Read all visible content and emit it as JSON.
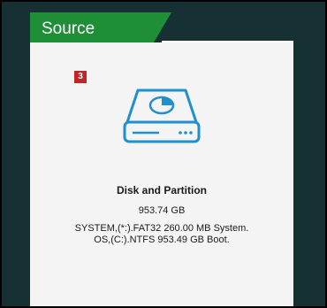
{
  "header": {
    "title": "Source"
  },
  "badge": {
    "number": "3"
  },
  "disk": {
    "icon": "hard-drive-icon",
    "title": "Disk and Partition",
    "size": "953.74 GB",
    "partitions": [
      "SYSTEM,(*:).FAT32 260.00 MB System.",
      "OS,(C:).NTFS 953.49 GB Boot."
    ]
  },
  "colors": {
    "header_green": "#1e8f36",
    "header_dark": "#163033",
    "icon_blue": "#1f8fd0",
    "badge_red": "#c0252a"
  }
}
